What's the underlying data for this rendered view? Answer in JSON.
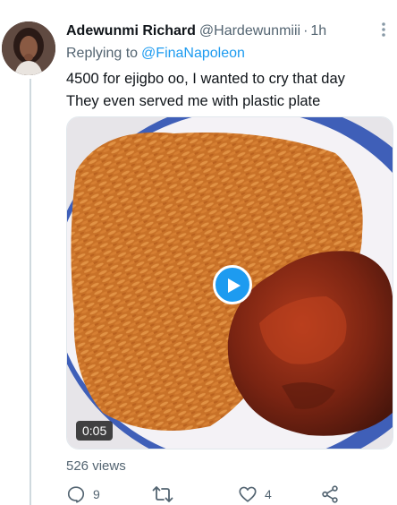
{
  "tweet": {
    "display_name": "Adewunmi Richard",
    "handle": "@Hardewunmiii",
    "separator": "·",
    "time": "1h",
    "replying_prefix": "Replying to",
    "replying_to": "@FinaNapoleon",
    "text_lines": [
      "4500 for ejigbo oo, I wanted to cry that day",
      "They even served me with plastic plate"
    ]
  },
  "media": {
    "type": "video",
    "duration": "0:05",
    "play_icon": "play-icon"
  },
  "stats": {
    "views": "526 views"
  },
  "actions": {
    "reply_count": "9",
    "retweet_count": "",
    "like_count": "4"
  },
  "colors": {
    "accent": "#1d9bf0",
    "text": "#0f1419",
    "secondary": "#536471"
  }
}
